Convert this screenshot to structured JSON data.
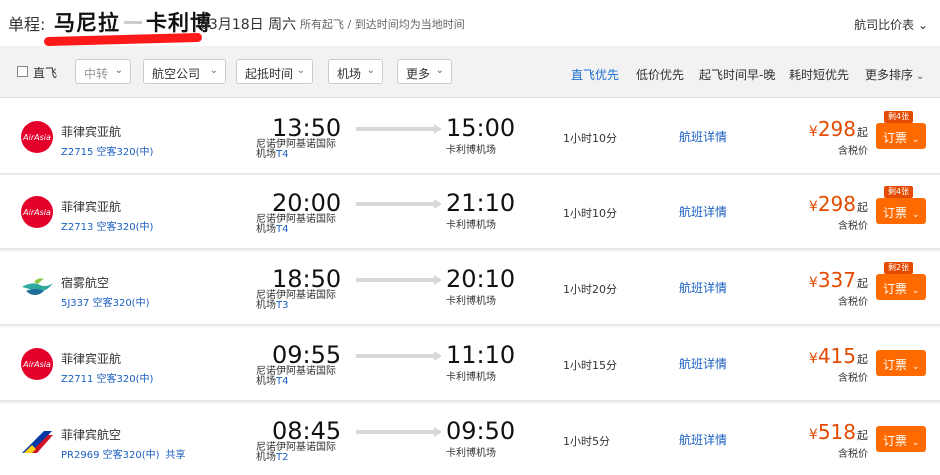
{
  "header": {
    "label": "单程:",
    "origin": "马尼拉",
    "destination": "卡利博",
    "date": "03月18日 周六",
    "note": "所有起飞 / 到达时间均为当地时间",
    "compare": "航司比价表",
    "accent_color": "#ff1a1a"
  },
  "filters": {
    "direct_label": "直飞",
    "dropdowns": [
      "中转",
      "航空公司",
      "起抵时间",
      "机场",
      "更多"
    ],
    "sorts": [
      "直飞优先",
      "低价优先",
      "起飞时间早-晚",
      "耗时短优先",
      "更多排序"
    ]
  },
  "flights": [
    {
      "airline": "菲律宾亚航",
      "logo": "airasia-logo",
      "flight_no": "Z2715",
      "aircraft": "空客320(中)",
      "share": "",
      "dep_time": "13:50",
      "dep_airport": "尼诺伊阿基诺国际机场",
      "dep_terminal": "T4",
      "arr_time": "15:00",
      "arr_airport": "卡利博机场",
      "duration": "1小时10分",
      "detail": "航班详情",
      "currency": "¥",
      "price": "298",
      "price_suffix": "起",
      "tax": "含税价",
      "badge": "剩4张",
      "book": "订票"
    },
    {
      "airline": "菲律宾亚航",
      "logo": "airasia-logo",
      "flight_no": "Z2713",
      "aircraft": "空客320(中)",
      "share": "",
      "dep_time": "20:00",
      "dep_airport": "尼诺伊阿基诺国际机场",
      "dep_terminal": "T4",
      "arr_time": "21:10",
      "arr_airport": "卡利博机场",
      "duration": "1小时10分",
      "detail": "航班详情",
      "currency": "¥",
      "price": "298",
      "price_suffix": "起",
      "tax": "含税价",
      "badge": "剩4张",
      "book": "订票"
    },
    {
      "airline": "宿雾航空",
      "logo": "cebupacific-logo",
      "flight_no": "5J337",
      "aircraft": "空客320(中)",
      "share": "",
      "dep_time": "18:50",
      "dep_airport": "尼诺伊阿基诺国际机场",
      "dep_terminal": "T3",
      "arr_time": "20:10",
      "arr_airport": "卡利博机场",
      "duration": "1小时20分",
      "detail": "航班详情",
      "currency": "¥",
      "price": "337",
      "price_suffix": "起",
      "tax": "含税价",
      "badge": "剩2张",
      "book": "订票"
    },
    {
      "airline": "菲律宾亚航",
      "logo": "airasia-logo",
      "flight_no": "Z2711",
      "aircraft": "空客320(中)",
      "share": "",
      "dep_time": "09:55",
      "dep_airport": "尼诺伊阿基诺国际机场",
      "dep_terminal": "T4",
      "arr_time": "11:10",
      "arr_airport": "卡利博机场",
      "duration": "1小时15分",
      "detail": "航班详情",
      "currency": "¥",
      "price": "415",
      "price_suffix": "起",
      "tax": "含税价",
      "badge": "",
      "book": "订票"
    },
    {
      "airline": "菲律宾航空",
      "logo": "philippineairlines-logo",
      "flight_no": "PR2969",
      "aircraft": "空客320(中)",
      "share": "共享",
      "dep_time": "08:45",
      "dep_airport": "尼诺伊阿基诺国际机场",
      "dep_terminal": "T2",
      "arr_time": "09:50",
      "arr_airport": "卡利博机场",
      "duration": "1小时5分",
      "detail": "航班详情",
      "currency": "¥",
      "price": "518",
      "price_suffix": "起",
      "tax": "含税价",
      "badge": "",
      "book": "订票"
    }
  ]
}
